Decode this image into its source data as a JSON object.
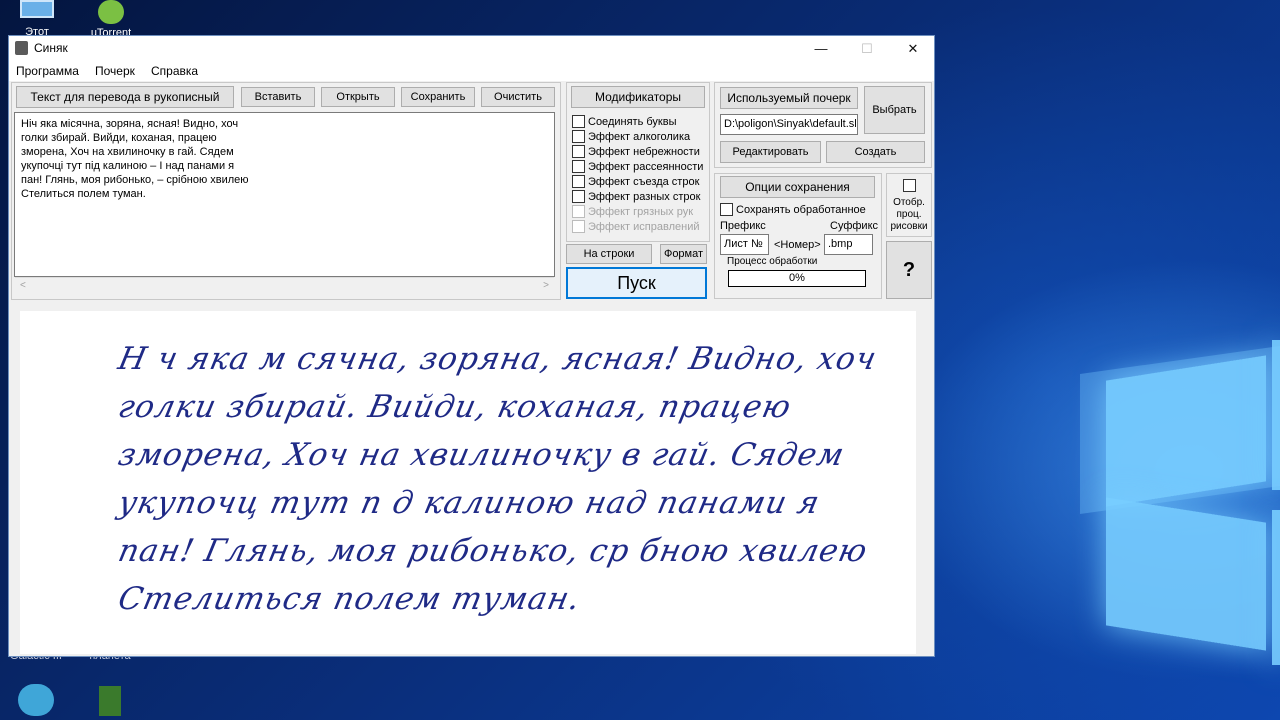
{
  "desktop": {
    "icons": [
      {
        "label": "Этот",
        "icon": "computer-icon"
      },
      {
        "label": "uTorrent",
        "icon": "utorrent-icon"
      },
      {
        "label": "Galactic III",
        "icon": "galaxy-icon"
      },
      {
        "label": "планета",
        "icon": "tree-icon"
      }
    ]
  },
  "window": {
    "title": "Синяк",
    "controls": {
      "minimize": "—",
      "maximize": "☐",
      "close": "✕"
    }
  },
  "menu": [
    "Программа",
    "Почерк",
    "Справка"
  ],
  "toolbar": {
    "text_label": "Текст для перевода в рукописный",
    "paste": "Вставить",
    "open": "Открыть",
    "save": "Сохранить",
    "clear": "Очистить"
  },
  "input_text": "Ніч яка місячна, зоряна, ясная! Видно, хоч\nголки збирай. Вийди, коханая, працею\nзморена, Хоч на хвилиночку в гай. Сядем\nукупочці тут під калиною – І над панами я\nпан! Глянь, моя рибонько, – срібною хвилею\nСтелиться полем туман.",
  "modifiers": {
    "title": "Модификаторы",
    "items": [
      {
        "label": "Соединять буквы",
        "checked": false,
        "enabled": true
      },
      {
        "label": "Эффект алкоголика",
        "checked": false,
        "enabled": true
      },
      {
        "label": "Эффект небрежности",
        "checked": false,
        "enabled": true
      },
      {
        "label": "Эффект рассеянности",
        "checked": false,
        "enabled": true
      },
      {
        "label": "Эффект съезда строк",
        "checked": false,
        "enabled": true
      },
      {
        "label": "Эффект разных строк",
        "checked": false,
        "enabled": true
      },
      {
        "label": "Эффект грязных рук",
        "checked": false,
        "enabled": false
      },
      {
        "label": "Эффект исправлений",
        "checked": false,
        "enabled": false
      }
    ],
    "on_lines": "На строки",
    "format": "Формат",
    "run": "Пуск"
  },
  "handwriting": {
    "title": "Используемый почерк",
    "path": "D:\\poligon\\Sinyak\\default.sl",
    "choose": "Выбрать",
    "edit": "Редактировать",
    "create": "Создать"
  },
  "save_options": {
    "title": "Опции сохранения",
    "save_processed": "Сохранять обработанное",
    "prefix_label": "Префикс",
    "suffix_label": "Суффикс",
    "prefix_value": "Лист №",
    "number_label": "<Номер>",
    "suffix_value": ".bmp",
    "progress_label": "Процесс обработки",
    "progress_text": "0%",
    "progress_value": 0
  },
  "side": {
    "show_drawing": "Отобр. проц. рисовки",
    "help": "?"
  },
  "output_lines": [
    "Н ч яка м сячна, зоряна, ясная! Видно, хоч",
    "голки збирай. Вийди, коханая, працею",
    "зморена, Хоч на хвилиночку в гай. Сядем",
    "укупочц  тут п д калиною      над панами я",
    "пан! Глянь, моя рибонько,    ср бною хвилею",
    "Стелиться полем туман."
  ]
}
